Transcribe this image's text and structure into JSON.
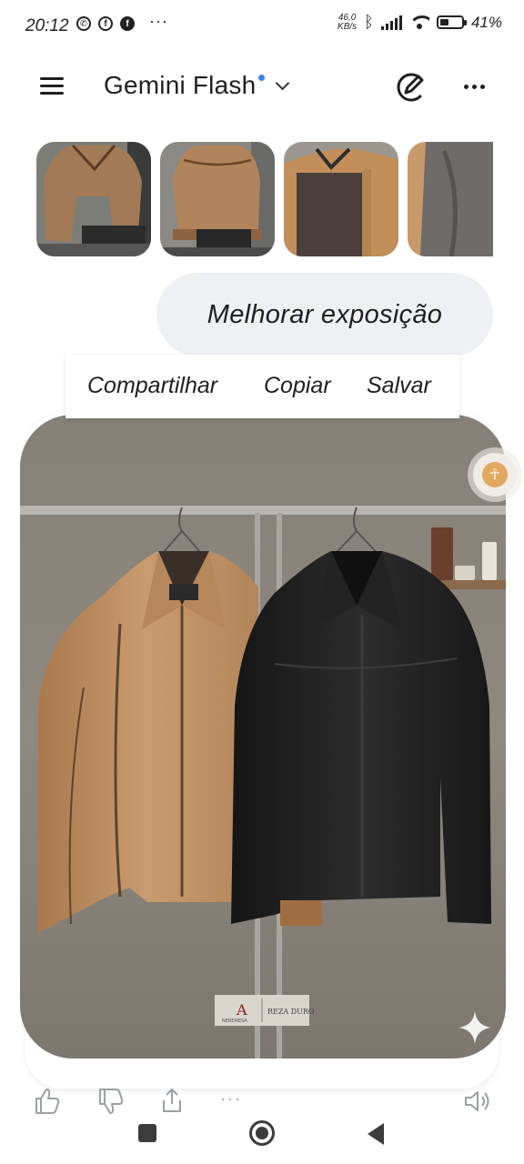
{
  "status_bar": {
    "time": "20:12",
    "net_speed_value": "46,0",
    "net_speed_unit": "KB/s",
    "battery_text": "41%",
    "battery_level": 0.41,
    "app_icons": [
      "whatsapp-icon",
      "facebook-icon",
      "facebook-icon"
    ],
    "more_notifications": "···"
  },
  "header": {
    "title": "Gemini Flash",
    "menu_icon": "hamburger-icon",
    "edit_icon": "edit-chat-icon",
    "more_icon": "more-horizontal-icon"
  },
  "attachments": {
    "thumbnails": [
      {
        "icon": "image-thumbnail"
      },
      {
        "icon": "image-thumbnail"
      },
      {
        "icon": "image-thumbnail"
      },
      {
        "icon": "image-thumbnail"
      }
    ]
  },
  "user_message": {
    "text": "Melhorar exposição"
  },
  "context_menu": {
    "share": "Compartilhar",
    "copy": "Copiar",
    "save": "Salvar"
  },
  "response": {
    "image_icon": "generated-image",
    "sparkle_icon": "gemini-sparkle-icon",
    "label_brand": "A",
    "label_subtitle": "NEREMESA",
    "label_right": "REZA DURO"
  },
  "actions": {
    "like": "thumbs-up-icon",
    "dislike": "thumbs-down-icon",
    "share": "share-icon",
    "more": "···",
    "speak": "speaker-icon"
  },
  "colors": {
    "accent_dot": "#3b82f6",
    "bubble_bg": "#eef0f4",
    "access_orange": "#e2a860"
  }
}
